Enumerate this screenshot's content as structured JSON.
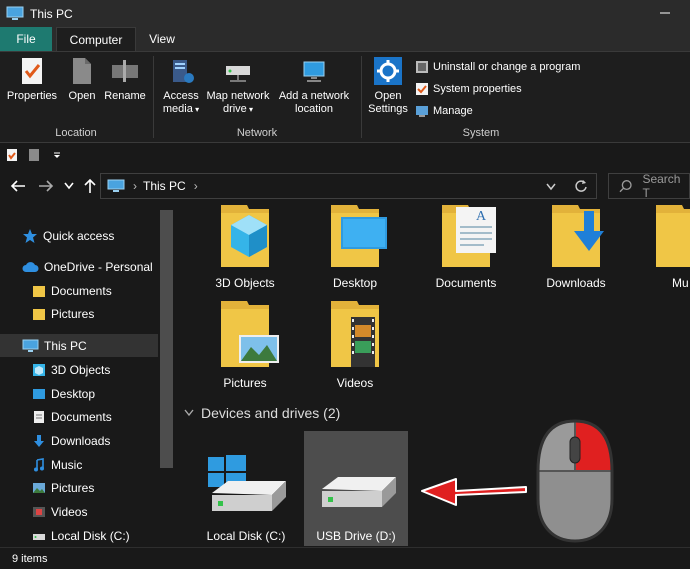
{
  "window": {
    "title": "This PC"
  },
  "ribbon_tabs": {
    "file": "File",
    "computer": "Computer",
    "view": "View"
  },
  "ribbon": {
    "location": {
      "label": "Location",
      "properties": "Properties",
      "open": "Open",
      "rename": "Rename"
    },
    "network": {
      "label": "Network",
      "access_media_line1": "Access",
      "access_media_line2": "media",
      "map_drive_line1": "Map network",
      "map_drive_line2": "drive",
      "add_location_line1": "Add a network",
      "add_location_line2": "location"
    },
    "system": {
      "label": "System",
      "open_settings_line1": "Open",
      "open_settings_line2": "Settings",
      "uninstall": "Uninstall or change a program",
      "system_properties": "System properties",
      "manage": "Manage"
    }
  },
  "address": {
    "path": "This PC",
    "separator": "›"
  },
  "search": {
    "placeholder": "Search T"
  },
  "sidebar": {
    "items": [
      {
        "label": "Quick access",
        "icon": "star-icon"
      },
      {
        "label": "OneDrive - Personal",
        "icon": "cloud-icon"
      },
      {
        "label": "Documents",
        "icon": "folder-icon"
      },
      {
        "label": "Pictures",
        "icon": "folder-icon"
      },
      {
        "label": "This PC",
        "icon": "pc-icon"
      },
      {
        "label": "3D Objects",
        "icon": "cube-icon"
      },
      {
        "label": "Desktop",
        "icon": "desktop-icon"
      },
      {
        "label": "Documents",
        "icon": "document-icon"
      },
      {
        "label": "Downloads",
        "icon": "download-icon"
      },
      {
        "label": "Music",
        "icon": "music-icon"
      },
      {
        "label": "Pictures",
        "icon": "picture-icon"
      },
      {
        "label": "Videos",
        "icon": "video-icon"
      },
      {
        "label": "Local Disk (C:)",
        "icon": "drive-icon"
      }
    ]
  },
  "folders": {
    "items": [
      {
        "label": "3D Objects"
      },
      {
        "label": "Desktop"
      },
      {
        "label": "Documents"
      },
      {
        "label": "Downloads"
      },
      {
        "label": "Mu"
      },
      {
        "label": "Pictures"
      },
      {
        "label": "Videos"
      }
    ]
  },
  "devices": {
    "header": "Devices and drives (2)",
    "drives": [
      {
        "label": "Local Disk (C:)"
      },
      {
        "label": "USB Drive (D:)"
      }
    ]
  },
  "status": {
    "item_count": "9 items"
  },
  "colors": {
    "accent_file_tab": "#1e7a70",
    "folder_yellow": "#f0c646",
    "arrow_red": "#e02020"
  }
}
